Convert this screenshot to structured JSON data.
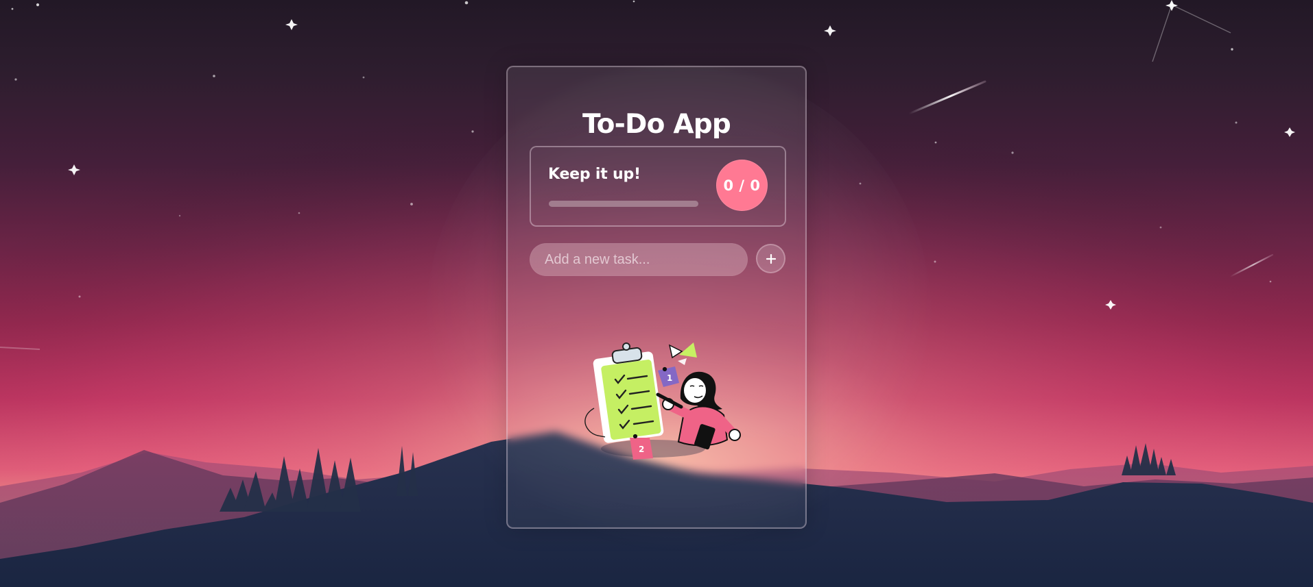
{
  "app": {
    "title": "To-Do App",
    "progress_message": "Keep it up!",
    "progress_counter": "0 / 0",
    "progress_fraction": 0,
    "input_placeholder": "Add a new task...",
    "input_value": "",
    "add_button_icon": "plus-icon"
  },
  "theme": {
    "accent": "#ff7993",
    "card_border": "#e3d3de",
    "input_bg": "#ddb4c2",
    "title_color": "#ffffff"
  }
}
